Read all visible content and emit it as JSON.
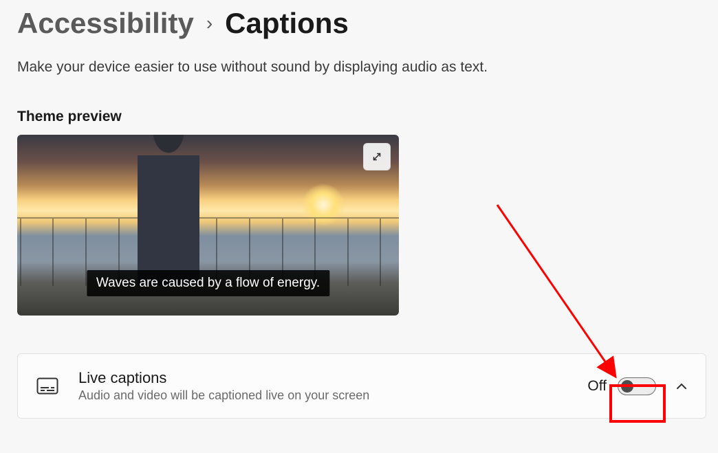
{
  "breadcrumb": {
    "parent": "Accessibility",
    "current": "Captions"
  },
  "description": "Make your device easier to use without sound by displaying audio as text.",
  "preview": {
    "heading": "Theme preview",
    "caption_sample": "Waves are caused by a flow of energy."
  },
  "live_captions": {
    "title": "Live captions",
    "subtitle": "Audio and video will be captioned live on your screen",
    "state_label": "Off"
  },
  "annotation": {
    "arrow_color": "#ff0000"
  }
}
